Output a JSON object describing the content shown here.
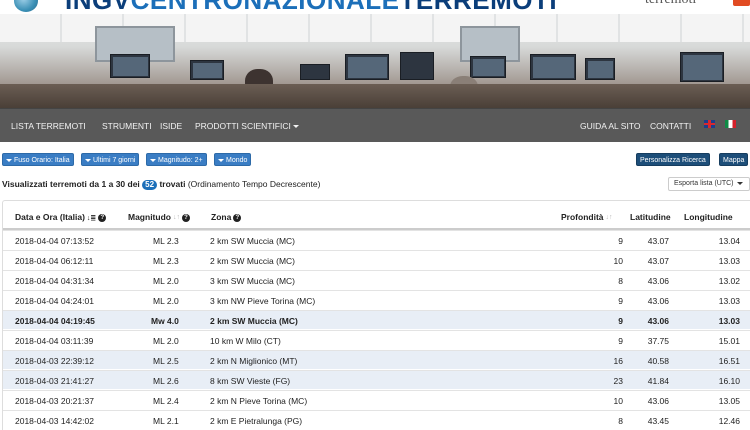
{
  "header": {
    "brand_ingv": "INGV",
    "brand_centro": "CENTRONAZIONALE",
    "brand_terremoti": "TERREMOTI",
    "right_logo": "terremoti"
  },
  "nav": {
    "left": [
      "LISTA TERREMOTI",
      "STRUMENTI",
      "ISIDE",
      "PRODOTTI SCIENTIFICI"
    ],
    "right": [
      "GUIDA AL SITO",
      "CONTATTI"
    ]
  },
  "filters": {
    "timezone": "Fuso Orario: Italia",
    "period": "Ultimi 7 giorni",
    "magnitude": "Magnitudo: 2+",
    "area": "Mondo",
    "customize": "Personalizza Ricerca",
    "map": "Mappa"
  },
  "summary": {
    "prefix": "Visualizzati terremoti da 1 a 30 dei",
    "count": "52",
    "suffix": "trovati",
    "order": "(Ordinamento Tempo Decrescente)",
    "export": "Esporta lista (UTC)"
  },
  "table": {
    "headers": {
      "datetime": "Data e Ora (Italia)",
      "magnitude": "Magnitudo",
      "zone": "Zona",
      "depth": "Profondità",
      "lat": "Latitudine",
      "lon": "Longitudine"
    },
    "rows": [
      {
        "datetime": "2018-04-04 07:13:52",
        "mag": "ML 2.3",
        "zone": "2 km SW Muccia (MC)",
        "depth": "9",
        "lat": "43.07",
        "lon": "13.04"
      },
      {
        "datetime": "2018-04-04 06:12:11",
        "mag": "ML 2.3",
        "zone": "2 km SW Muccia (MC)",
        "depth": "10",
        "lat": "43.07",
        "lon": "13.03"
      },
      {
        "datetime": "2018-04-04 04:31:34",
        "mag": "ML 2.0",
        "zone": "3 km SW Muccia (MC)",
        "depth": "8",
        "lat": "43.06",
        "lon": "13.02"
      },
      {
        "datetime": "2018-04-04 04:24:01",
        "mag": "ML 2.0",
        "zone": "3 km NW Pieve Torina (MC)",
        "depth": "9",
        "lat": "43.06",
        "lon": "13.03"
      },
      {
        "datetime": "2018-04-04 04:19:45",
        "mag": "Mw 4.0",
        "zone": "2 km SW Muccia (MC)",
        "depth": "9",
        "lat": "43.06",
        "lon": "13.03"
      },
      {
        "datetime": "2018-04-04 03:11:39",
        "mag": "ML 2.0",
        "zone": "10 km W Milo (CT)",
        "depth": "9",
        "lat": "37.75",
        "lon": "15.01"
      },
      {
        "datetime": "2018-04-03 22:39:12",
        "mag": "ML 2.5",
        "zone": "2 km N Miglionico (MT)",
        "depth": "16",
        "lat": "40.58",
        "lon": "16.51"
      },
      {
        "datetime": "2018-04-03 21:41:27",
        "mag": "ML 2.6",
        "zone": "8 km SW Vieste (FG)",
        "depth": "23",
        "lat": "41.84",
        "lon": "16.10"
      },
      {
        "datetime": "2018-04-03 20:21:37",
        "mag": "ML 2.4",
        "zone": "2 km N Pieve Torina (MC)",
        "depth": "10",
        "lat": "43.06",
        "lon": "13.05"
      },
      {
        "datetime": "2018-04-03 14:42:02",
        "mag": "ML 2.1",
        "zone": "2 km E Pietralunga (PG)",
        "depth": "8",
        "lat": "43.45",
        "lon": "12.46"
      }
    ]
  },
  "colors": {
    "brand_dark": "#0b3e7a",
    "brand_blue": "#1c6fb9",
    "navbar": "#595959",
    "highlight_row": "#e8eef6"
  }
}
